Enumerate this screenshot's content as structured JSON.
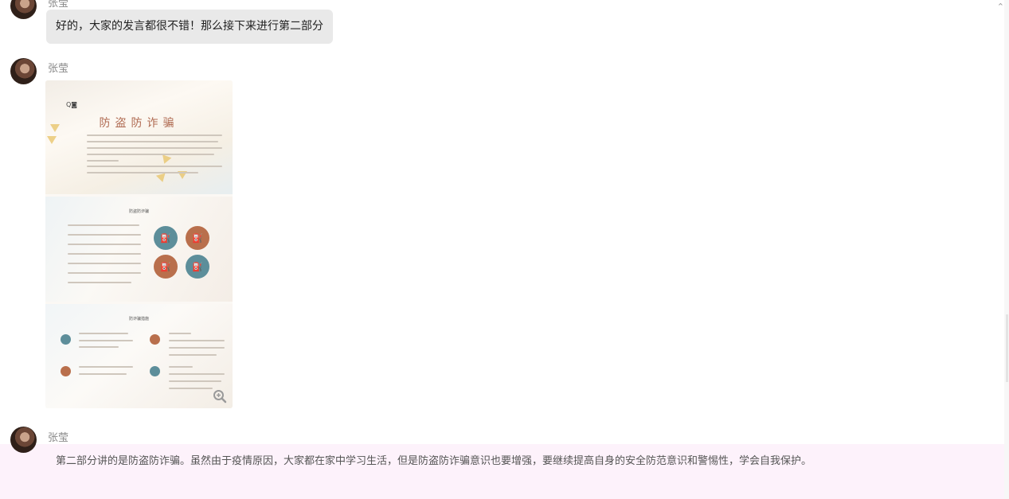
{
  "messages": [
    {
      "sender": "张莹",
      "text": "好的，大家的发言都很不错！那么接下来进行第二部分"
    },
    {
      "sender": "张莹",
      "image": {
        "slide1_title": "防盗防诈骗",
        "slide2_title": "防盗防诈骗",
        "slide3_title": "防诈骗措施",
        "icons": [
          "oil-pump-icon",
          "oil-pump-icon",
          "oil-pump-icon",
          "oil-pump-icon"
        ]
      }
    },
    {
      "sender": "张莹",
      "text": "第二部分讲的是防盗防诈骗。虽然由于疫情原因，大家都在家中学习生活，但是防盗防诈骗意识也要增强，要继续提高自身的安全防范意识和警惕性，学会自我保护。"
    }
  ],
  "colors": {
    "bubble": "#e9e9e9",
    "highlight": "#fdf2fb",
    "teal": "#5d8e9a",
    "rust": "#b96f4c"
  }
}
